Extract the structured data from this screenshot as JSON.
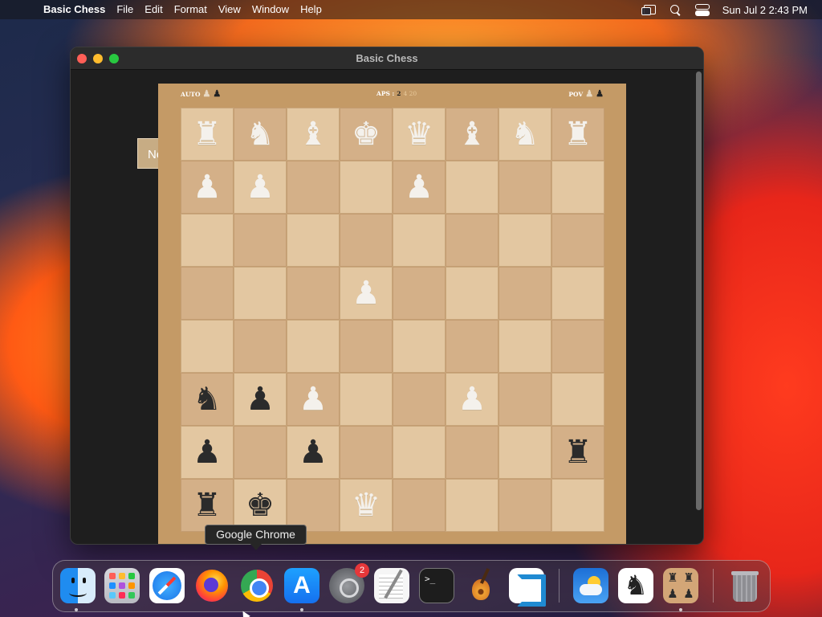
{
  "menubar": {
    "apple_icon": "apple-icon",
    "app_name": "Basic Chess",
    "menus": [
      "File",
      "Edit",
      "Format",
      "View",
      "Window",
      "Help"
    ],
    "status_icons": [
      "screen-mirroring-icon",
      "search-icon",
      "control-center-icon"
    ],
    "clock": "Sun Jul 2  2:43 PM"
  },
  "window": {
    "title": "Basic Chess",
    "new_game_button": "New Game",
    "header": {
      "auto_label": "AUTO",
      "aps_label": "APS :",
      "aps_value": "2",
      "aps_options": "4 20",
      "pov_label": "POV"
    },
    "board": {
      "light_square_color": "#e3c7a1",
      "dark_square_color": "#d4b088",
      "ranks": [
        [
          "wR",
          "wN",
          "wB",
          "wK",
          "wQ",
          "wB",
          "wN",
          "wR"
        ],
        [
          "wP",
          "wP",
          "",
          "",
          "wP",
          "",
          "",
          ""
        ],
        [
          "",
          "",
          "",
          "",
          "",
          "",
          "",
          ""
        ],
        [
          "",
          "",
          "",
          "wP",
          "",
          "",
          "",
          ""
        ],
        [
          "",
          "",
          "",
          "",
          "",
          "",
          "",
          ""
        ],
        [
          "bN",
          "bP",
          "wP",
          "",
          "",
          "wP",
          "",
          ""
        ],
        [
          "bP",
          "",
          "bP",
          "",
          "",
          "",
          "",
          "bR"
        ],
        [
          "bR",
          "bK",
          "",
          "wQ",
          "",
          "",
          "",
          ""
        ]
      ]
    }
  },
  "tooltip": {
    "text": "Google Chrome"
  },
  "dock": {
    "apps": [
      "Finder",
      "Launchpad",
      "Safari",
      "Firefox",
      "Google Chrome",
      "App Store",
      "System Settings",
      "TextEdit",
      "Terminal",
      "GarageBand",
      "Visual Studio Code",
      "Weather",
      "Chess",
      "Basic Chess",
      "Trash"
    ],
    "settings_badge": "2",
    "terminal_prompt": ">_"
  }
}
